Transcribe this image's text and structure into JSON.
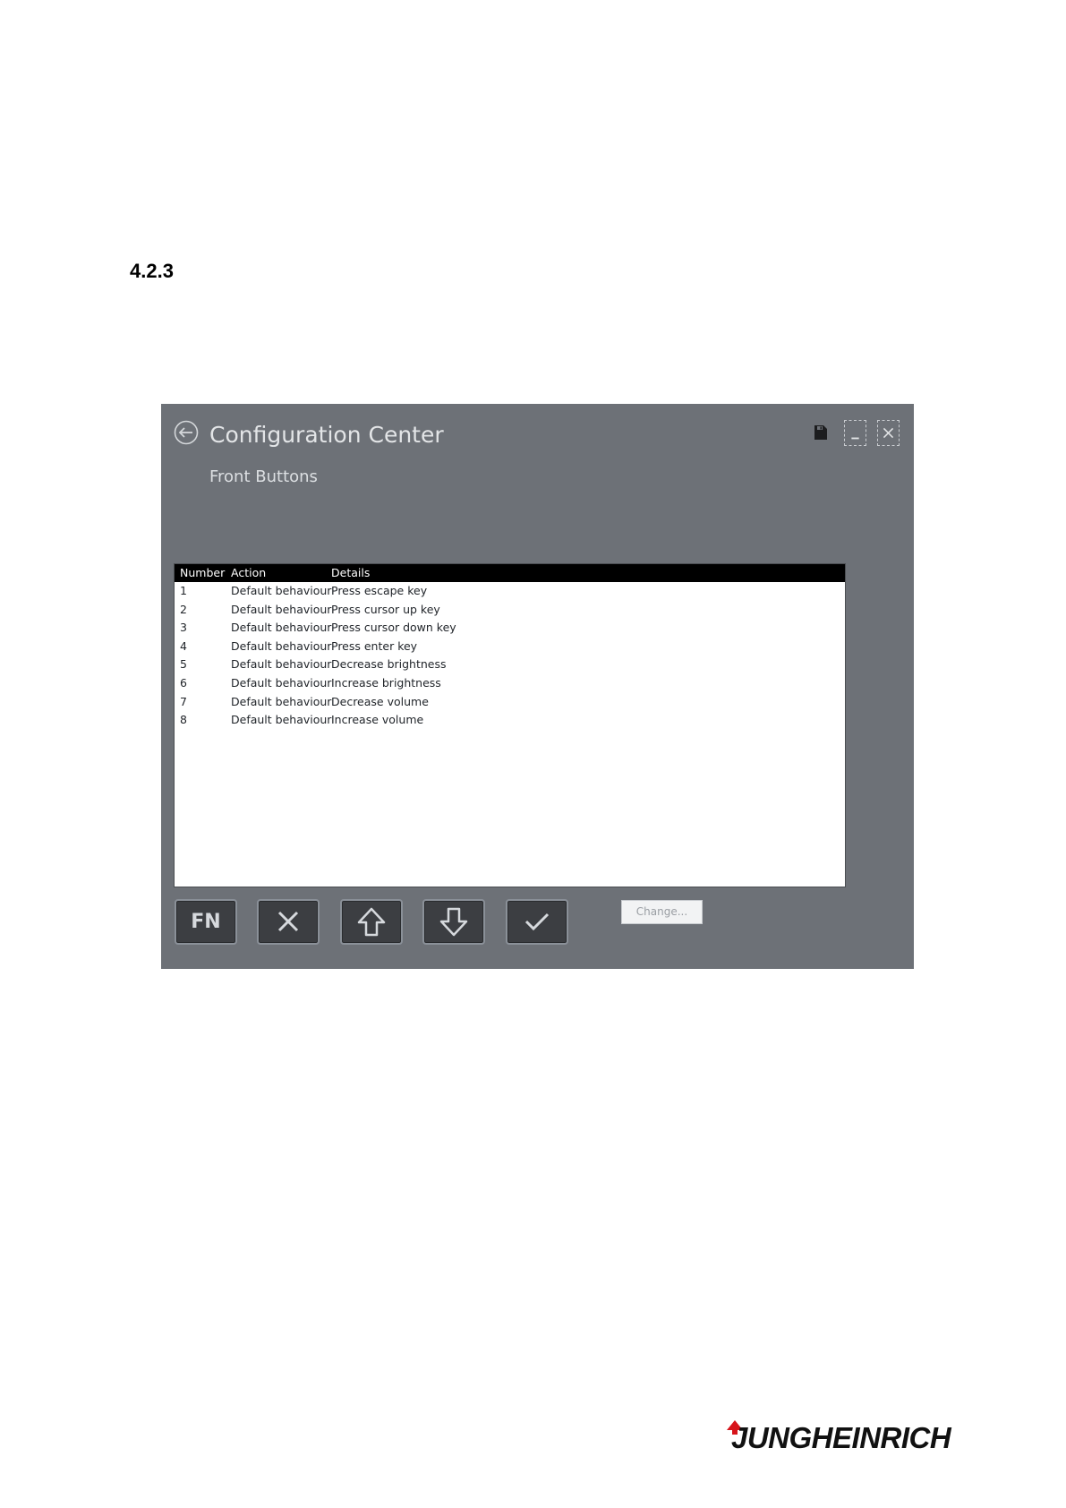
{
  "document": {
    "section_number": "4.2.3"
  },
  "window": {
    "title": "Configuration Center",
    "subtitle": "Front Buttons",
    "icons": [
      "back-arrow-icon",
      "save-icon",
      "minimize-icon",
      "close-icon"
    ]
  },
  "table": {
    "columns": [
      "Number",
      "Action",
      "Details"
    ],
    "rows": [
      {
        "number": "1",
        "action": "Default behaviour",
        "details": "Press escape key"
      },
      {
        "number": "2",
        "action": "Default behaviour",
        "details": "Press cursor up key"
      },
      {
        "number": "3",
        "action": "Default behaviour",
        "details": "Press cursor down key"
      },
      {
        "number": "4",
        "action": "Default behaviour",
        "details": "Press enter key"
      },
      {
        "number": "5",
        "action": "Default behaviour",
        "details": "Decrease brightness"
      },
      {
        "number": "6",
        "action": "Default behaviour",
        "details": "Increase brightness"
      },
      {
        "number": "7",
        "action": "Default behaviour",
        "details": "Decrease volume"
      },
      {
        "number": "8",
        "action": "Default behaviour",
        "details": "Increase volume"
      }
    ]
  },
  "keys": {
    "fn_label": "FN",
    "icons": [
      "fn-key",
      "cancel-x-icon",
      "arrow-up-icon",
      "arrow-down-icon",
      "checkmark-icon"
    ]
  },
  "change_button": {
    "label": "Change..."
  },
  "branding": {
    "logo_text": "JUNGHEINRICH",
    "logo_accent_color": "#d7141a"
  },
  "colors": {
    "window_bg": "#6d7177",
    "header_bg": "#000000",
    "key_bg": "#3c3e42"
  }
}
